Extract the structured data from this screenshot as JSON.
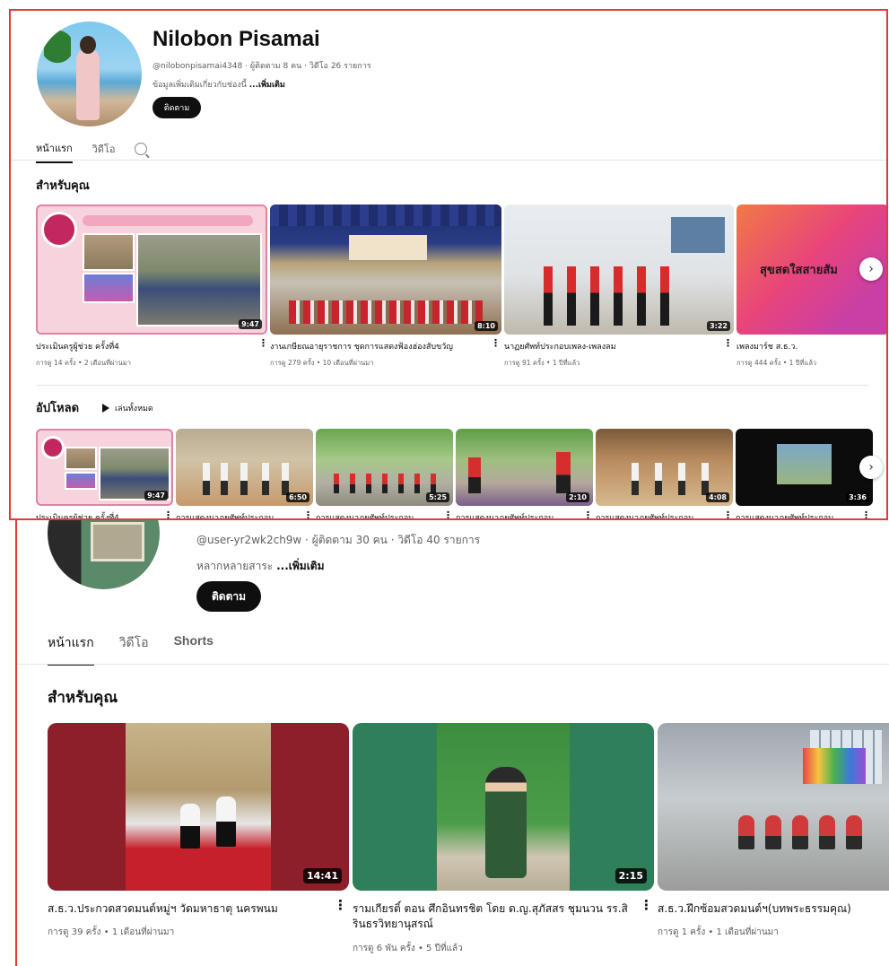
{
  "channel1": {
    "name": "Nilobon Pisamai",
    "meta": "@nilobonpisamai4348 · ผู้ติดตาม 8 คน · วิดีโอ 26 รายการ",
    "desc": "ข้อมูลเพิ่มเติมเกี่ยวกับช่องนี้",
    "desc_more": "...เพิ่มเติม",
    "subscribe": "ติดตาม",
    "tabs": [
      "หน้าแรก",
      "วิดีโอ"
    ],
    "for_you_title": "สำหรับคุณ",
    "uploads_title": "อัปโหลด",
    "play_all": "เล่นทั้งหมด",
    "for_you_videos": [
      {
        "title": "ประเมินครูผู้ช่วย ครั้งที่4",
        "meta": "การดู 14 ครั้ง • 2 เดือนที่ผ่านมา",
        "duration": "9:47"
      },
      {
        "title": "งานเกษียณอายุราชการ ชุดการแสดงฟ้องฮ่องสับขวัญ",
        "meta": "การดู 279 ครั้ง • 10 เดือนที่ผ่านมา",
        "duration": "8:10"
      },
      {
        "title": "นาฏยศัพท์ประกอบเพลง-เพลงลม",
        "meta": "การดู 91 ครั้ง • 1 ปีที่แล้ว",
        "duration": "3:22"
      },
      {
        "title": "เพลงมาร์ช ส.ธ.ว.",
        "meta": "การดู 444 ครั้ง • 1 ปีที่แล้ว",
        "duration": "",
        "thumb_text": "สุขสดใสสายสัม"
      }
    ],
    "uploads": [
      {
        "title": "ประเมินครูผู้ช่วย ครั้งที่4",
        "duration": "9:47"
      },
      {
        "title": "การแสดงนาฏยศัพท์ประกอบ",
        "duration": "6:50"
      },
      {
        "title": "การแสดงนาฏยศัพท์ประกอบ",
        "duration": "5:25"
      },
      {
        "title": "การแสดงนาฏยศัพท์ประกอบ",
        "duration": "2:10"
      },
      {
        "title": "การแสดงนาฏยศัพท์ประกอบ",
        "duration": "4:08"
      },
      {
        "title": "การแสดงนาฏยศัพท์ประกอบ",
        "duration": "3:36"
      }
    ]
  },
  "channel2": {
    "meta": "@user-yr2wk2ch9w · ผู้ติดตาม 30 คน · วิดีโอ 40 รายการ",
    "desc": "หลากหลายสาระ",
    "desc_more": "...เพิ่มเติม",
    "subscribe": "ติดตาม",
    "tabs": [
      "หน้าแรก",
      "วิดีโอ",
      "Shorts"
    ],
    "for_you_title": "สำหรับคุณ",
    "videos": [
      {
        "title": "ส.ธ.ว.ประกวดสวดมนต์หมู่ฯ วัดมหาธาตุ นครพนม",
        "meta": "การดู 39 ครั้ง • 1 เดือนที่ผ่านมา",
        "duration": "14:41"
      },
      {
        "title": "รามเกียรติ์ ตอน ศึกอินทรชิต โดย ด.ญ.สุภัสสร ชุมนวน รร.สิรินธรวิทยานุสรณ์",
        "meta": "การดู 6 พัน ครั้ง • 5 ปีที่แล้ว",
        "duration": "2:15"
      },
      {
        "title": "ส.ธ.ว.ฝึกซ้อมสวดมนต์ฯ(บทพระธรรมคุณ)",
        "meta": "การดู 1 ครั้ง • 1 เดือนที่ผ่านมา",
        "duration": ""
      }
    ]
  },
  "colors": {
    "highlight_border": "#e53935",
    "button_bg": "#0f0f0f"
  }
}
